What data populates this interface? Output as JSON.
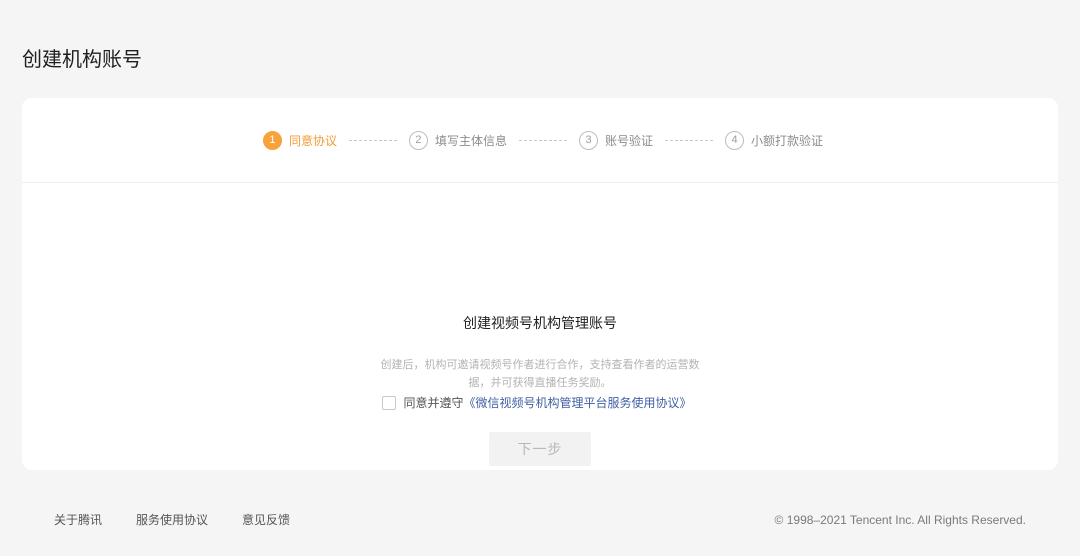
{
  "page": {
    "title": "创建机构账号"
  },
  "steps": [
    {
      "number": "1",
      "label": "同意协议",
      "active": true
    },
    {
      "number": "2",
      "label": "填写主体信息",
      "active": false
    },
    {
      "number": "3",
      "label": "账号验证",
      "active": false
    },
    {
      "number": "4",
      "label": "小额打款验证",
      "active": false
    }
  ],
  "main": {
    "title": "创建视频号机构管理账号",
    "description_line1": "创建后，机构可邀请视频号作者进行合作，支持查看作者的运营数",
    "description_line2": "据，并可获得直播任务奖励。",
    "agree_prefix": "同意并遵守",
    "agree_link": "《微信视频号机构管理平台服务使用协议》",
    "next_label": "下一步"
  },
  "footer": {
    "links": [
      "关于腾讯",
      "服务使用协议",
      "意见反馈"
    ],
    "copyright": "© 1998–2021 Tencent Inc. All Rights Reserved."
  },
  "colors": {
    "accent": "#f7a23b",
    "link": "#3f5fa3",
    "background": "#f5f5f5"
  }
}
